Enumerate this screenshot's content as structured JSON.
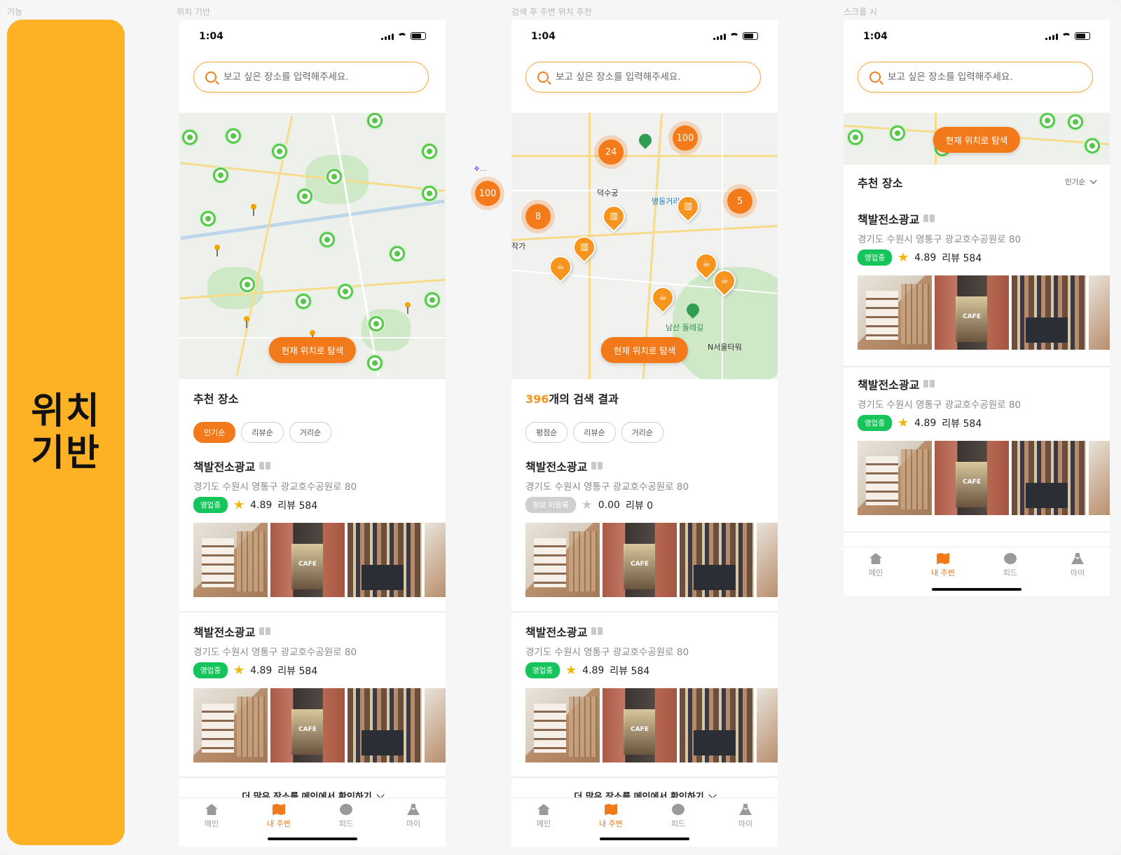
{
  "labels": {
    "feature": "기능",
    "frame1": "위치 기반",
    "frame2": "검색 후 주변 위치 추천",
    "frame3": "스크롤 시"
  },
  "sidebar": {
    "title": "위치\n기반",
    "color": "#FDB225"
  },
  "status": {
    "time": "1:04"
  },
  "search": {
    "placeholder": "보고 싶은 장소를 입력해주세요."
  },
  "map": {
    "explore_button": "현재 위치로 탐색",
    "floating_cluster": "100",
    "frame2_clusters": [
      "24",
      "100",
      "8",
      "5"
    ],
    "frame2_place_labels": [
      "덕수궁",
      "명동거리",
      "남산 둘레길",
      "N서울타워",
      "작가"
    ]
  },
  "frame1": {
    "section_title": "추천 장소",
    "chips": [
      "인기순",
      "리뷰순",
      "거리순"
    ]
  },
  "frame2": {
    "result_count": "396",
    "result_suffix": "개의 검색 결과",
    "chips": [
      "평점순",
      "리뷰순",
      "거리순"
    ]
  },
  "frame3": {
    "section_title": "추천 장소",
    "sort_label": "인기순"
  },
  "place": {
    "name": "책발전소광교",
    "address": "경기도 수원시 영통구 광교호수공원로 80",
    "status_open": "영업중",
    "status_unregistered": "정보 미등록",
    "rating": "4.89",
    "reviews": "리뷰 584",
    "rating_zero": "0.00",
    "reviews_zero": "리뷰 0"
  },
  "more_link": "더 많은 장소를 메인에서 확인하기",
  "tabbar": {
    "home": "메인",
    "nearby": "내 주변",
    "feed": "피드",
    "my": "마이"
  },
  "colors": {
    "accent": "#F27A1A",
    "open_badge": "#15C45A",
    "cluster_green": "#55C74A"
  }
}
